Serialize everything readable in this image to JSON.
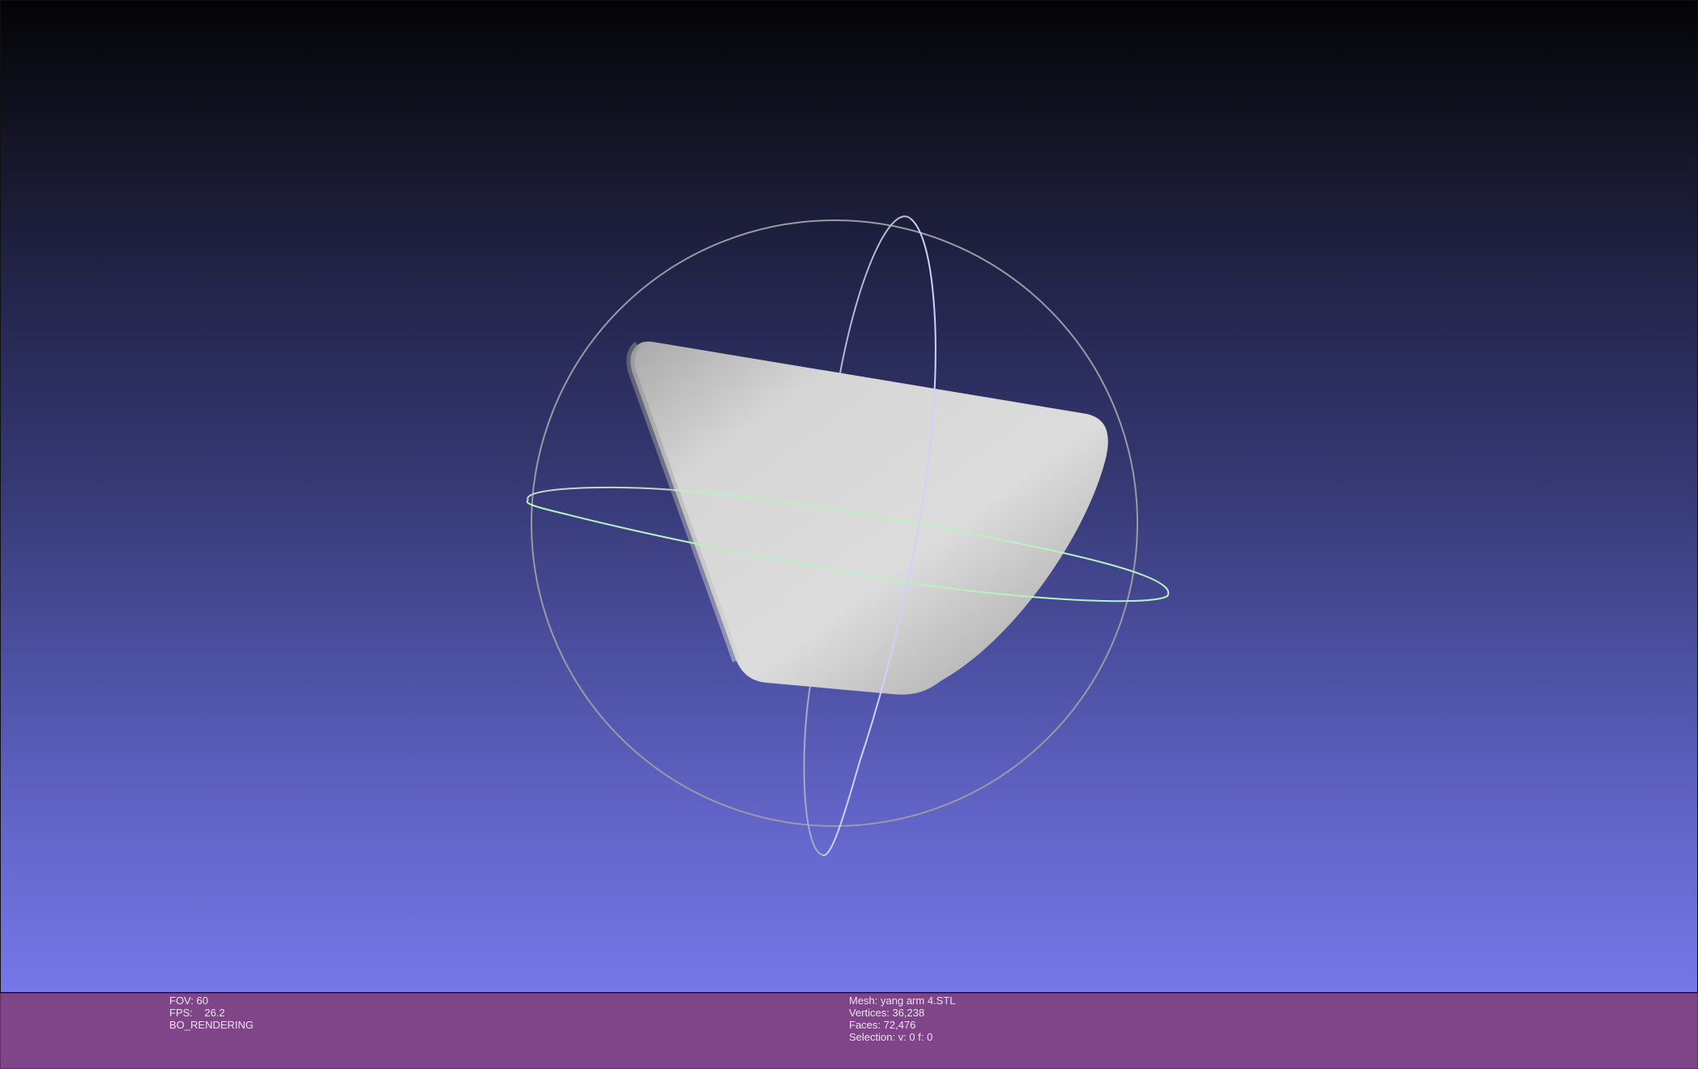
{
  "viewport": {
    "label": "3D viewport",
    "gradient_top": "#040407",
    "gradient_bottom": "#7677e8",
    "mesh_color": "#d4d4d4",
    "trackball_colors": {
      "sphere": "#9a99a6",
      "vertical_ring": "#cfd0ff",
      "horizontal_ring": "#b6f2c2"
    }
  },
  "info_bar": {
    "background": "#7f4588",
    "left": {
      "fov": "FOV: 60",
      "fps": "FPS:    26.2",
      "mode": "BO_RENDERING"
    },
    "right": {
      "mesh": "Mesh: yang arm 4.STL",
      "vertices": "Vertices: 36,238",
      "faces": "Faces: 72,476",
      "selection": "Selection: v: 0 f: 0"
    }
  }
}
